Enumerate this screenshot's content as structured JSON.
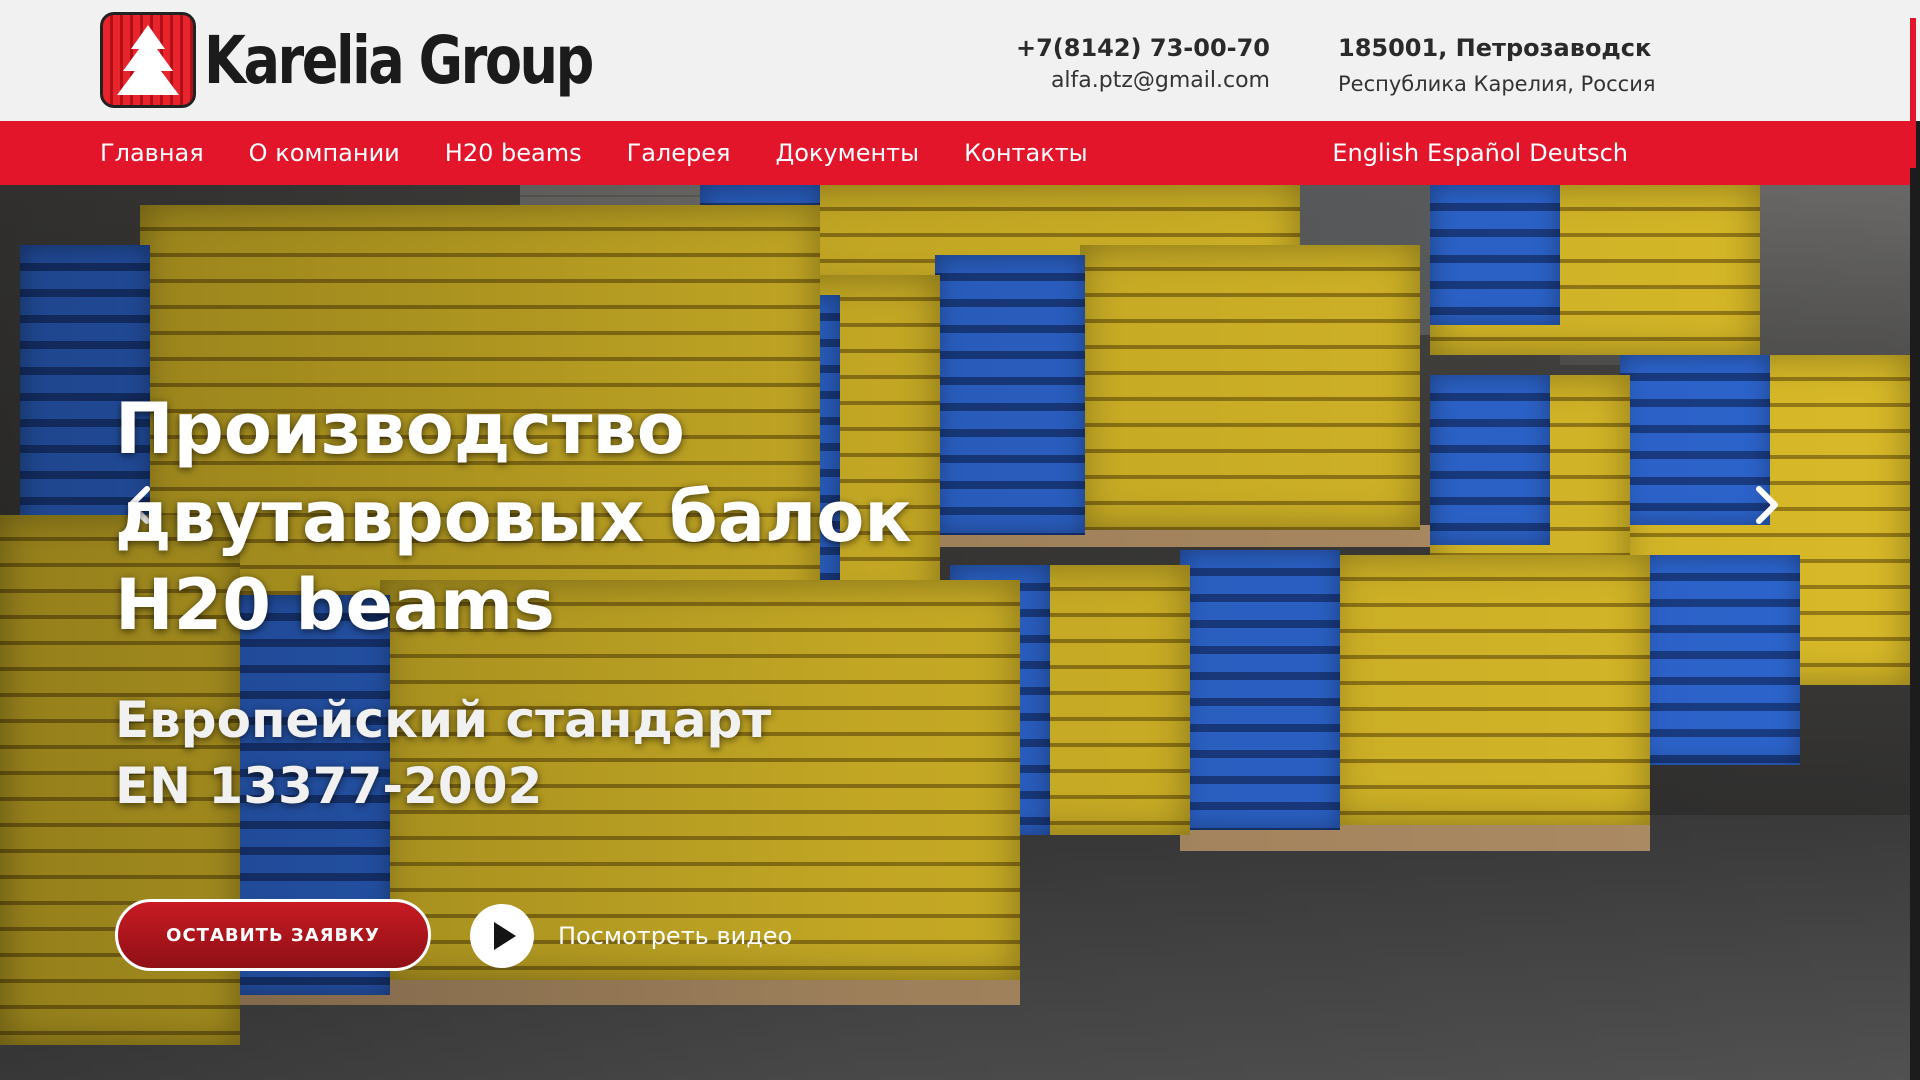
{
  "header": {
    "logo_text": "Karelia Group",
    "phone": "+7(8142) 73-00-70",
    "email": "alfa.ptz@gmail.com",
    "address_line1": "185001,  Петрозаводск",
    "address_line2": "Республика Карелия, Россия"
  },
  "nav": {
    "items": [
      {
        "label": "Главная"
      },
      {
        "label": "О компании"
      },
      {
        "label": "H20 beams"
      },
      {
        "label": "Галерея"
      },
      {
        "label": "Документы"
      },
      {
        "label": "Контакты"
      }
    ],
    "languages": [
      {
        "label": "English"
      },
      {
        "label": "Español"
      },
      {
        "label": "Deutsch"
      }
    ]
  },
  "hero": {
    "title_lines": [
      "Производство",
      "двутавровых балок",
      "H20 beams"
    ],
    "subtitle_lines": [
      "Европейский стандарт",
      "EN 13377-2002"
    ],
    "cta_label": "ОСТАВИТЬ ЗАЯВКУ",
    "video_label": "Посмотреть видео"
  },
  "icons": {
    "prev": "chevron-left-icon",
    "next": "chevron-right-icon",
    "play": "play-icon",
    "logo": "spruce-tree-logo-icon"
  },
  "colors": {
    "brand_red": "#e2152b",
    "header_bg": "#f1f1f1",
    "cta_red": "#c81a23"
  }
}
